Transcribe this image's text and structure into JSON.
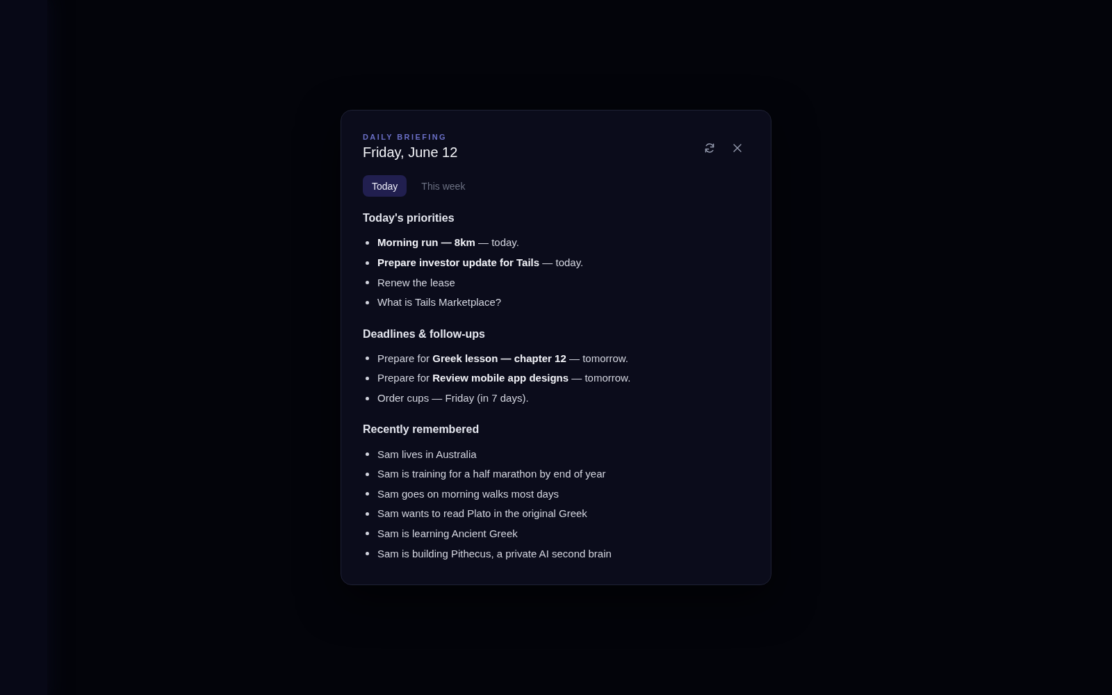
{
  "dialog": {
    "eyebrow": "DAILY BRIEFING",
    "title": "Friday, June 12",
    "tabs": [
      {
        "label": "Today",
        "selected": true
      },
      {
        "label": "This week",
        "selected": false
      }
    ],
    "sections": [
      {
        "heading": "Today's priorities",
        "items": [
          "**Morning run — 8km** — today.",
          "**Prepare investor update for Tails** — today.",
          "Renew the lease",
          "What is Tails Marketplace?"
        ]
      },
      {
        "heading": "Deadlines & follow-ups",
        "items": [
          "Prepare for **Greek lesson — chapter 12** — tomorrow.",
          "Prepare for **Review mobile app designs** — tomorrow.",
          "Order cups — Friday (in 7 days)."
        ]
      },
      {
        "heading": "Recently remembered",
        "items": [
          "Sam lives in Australia",
          "Sam is training for a half marathon by end of year",
          "Sam goes on morning walks most days",
          "Sam wants to read Plato in the original Greek",
          "Sam is learning Ancient Greek",
          "Sam is building Pithecus, a private AI second brain"
        ]
      }
    ]
  }
}
